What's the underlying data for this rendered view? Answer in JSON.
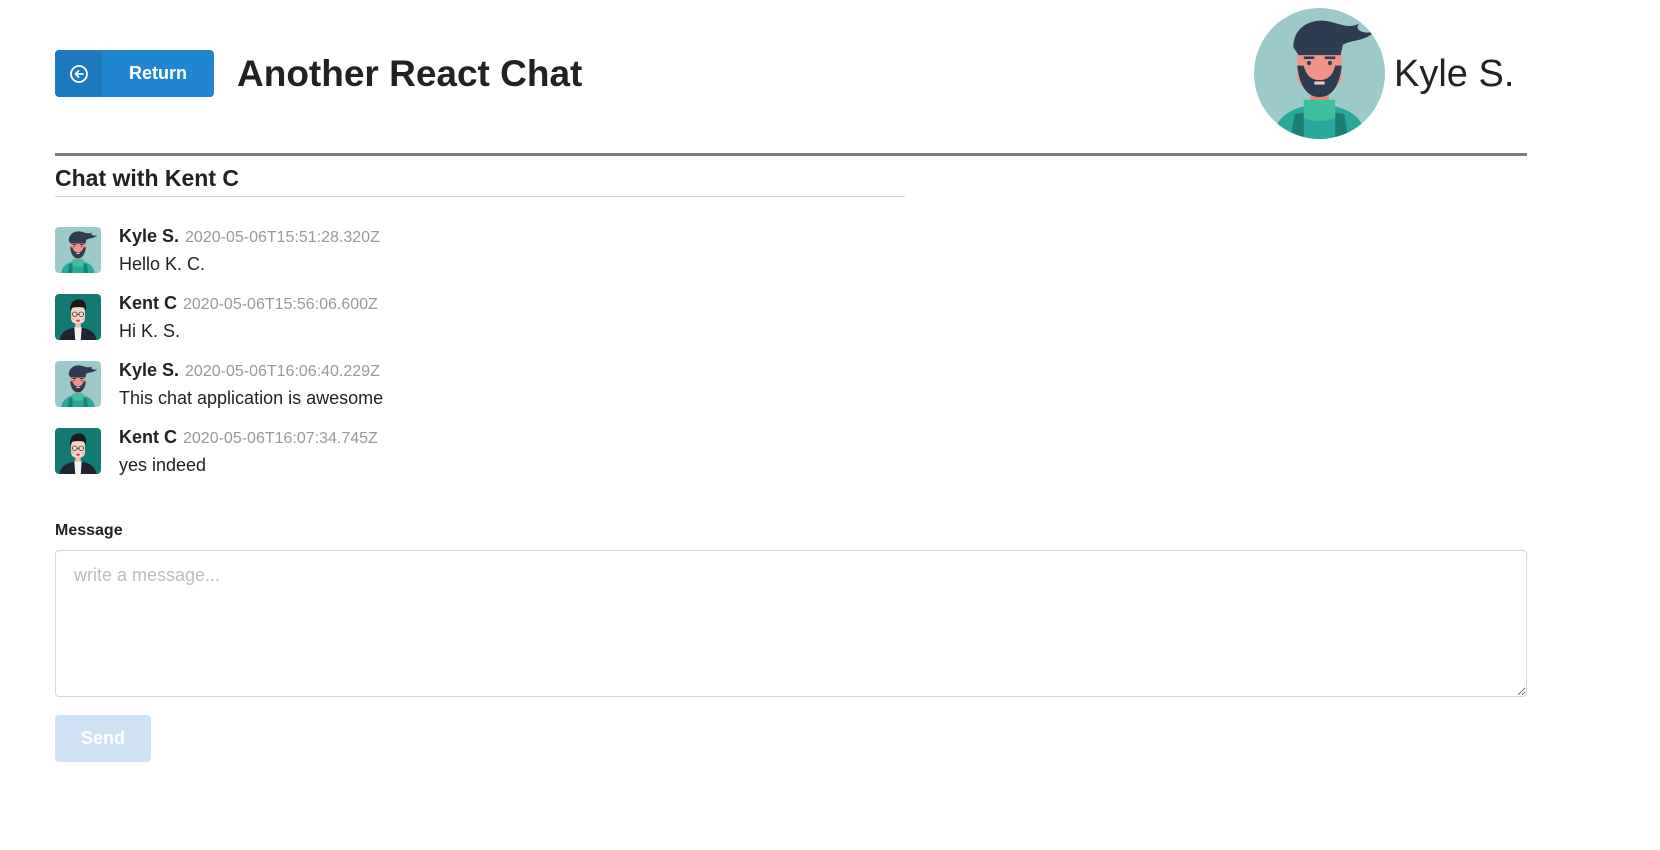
{
  "header": {
    "return_label": "Return",
    "app_title": "Another React Chat",
    "current_user": {
      "name": "Kyle S.",
      "avatar_icon": "avatar-kyle"
    }
  },
  "chat": {
    "heading": "Chat with Kent C",
    "messages": [
      {
        "author": "Kyle S.",
        "timestamp": "2020-05-06T15:51:28.320Z",
        "text": "Hello K. C.",
        "avatar_icon": "avatar-kyle"
      },
      {
        "author": "Kent C",
        "timestamp": "2020-05-06T15:56:06.600Z",
        "text": "Hi K. S.",
        "avatar_icon": "avatar-kent"
      },
      {
        "author": "Kyle S.",
        "timestamp": "2020-05-06T16:06:40.229Z",
        "text": "This chat application is awesome",
        "avatar_icon": "avatar-kyle"
      },
      {
        "author": "Kent C",
        "timestamp": "2020-05-06T16:07:34.745Z",
        "text": "yes indeed",
        "avatar_icon": "avatar-kent"
      }
    ]
  },
  "composer": {
    "label": "Message",
    "value": "",
    "placeholder": "write a message...",
    "send_label": "Send"
  },
  "colors": {
    "primary": "#2185d0",
    "send_disabled": "#cfe3f4",
    "timestamp": "#9a9a9a",
    "divider": "#7b7b7b"
  }
}
